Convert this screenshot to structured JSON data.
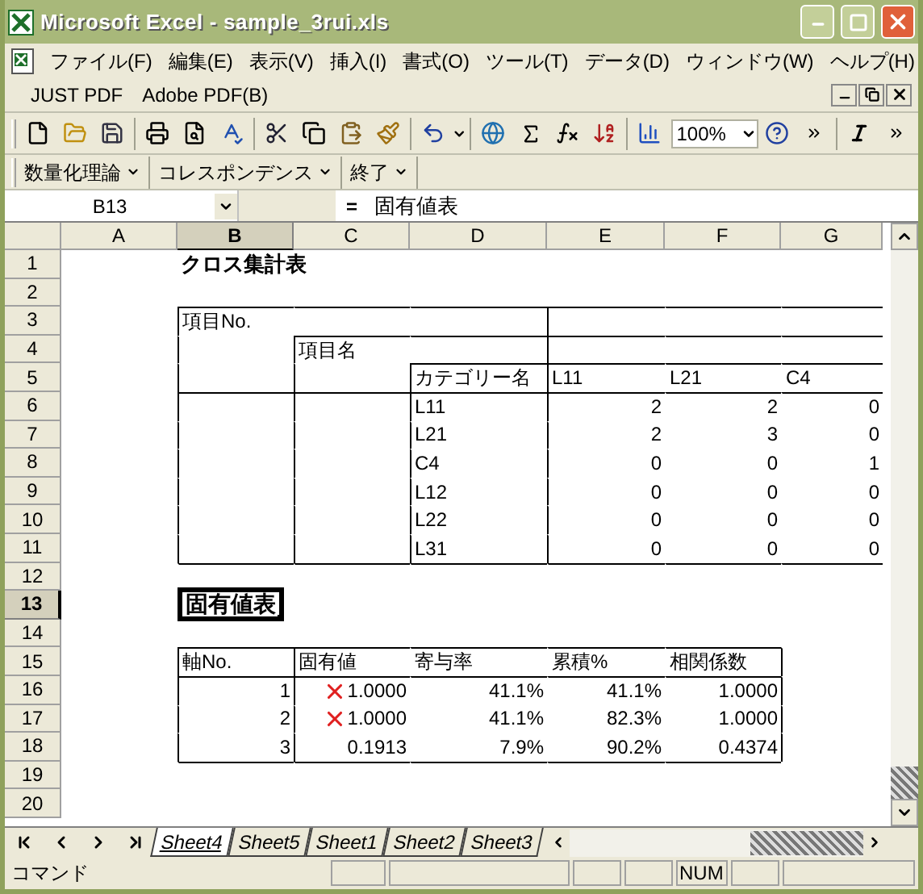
{
  "window": {
    "title": "Microsoft Excel - sample_3rui.xls"
  },
  "menu": [
    "ファイル(F)",
    "編集(E)",
    "表示(V)",
    "挿入(I)",
    "書式(O)",
    "ツール(T)",
    "データ(D)",
    "ウィンドウ(W)",
    "ヘルプ(H)"
  ],
  "menu_row2": [
    "JUST PDF",
    "Adobe PDF(B)"
  ],
  "zoom": "100%",
  "addin_menu": [
    "数量化理論",
    "コレスポンデンス",
    "終了"
  ],
  "name_box": "B13",
  "formula_equals": "=",
  "formula": "固有値表",
  "columns": [
    {
      "label": "A",
      "selected": false
    },
    {
      "label": "B",
      "selected": true
    },
    {
      "label": "C",
      "selected": false
    },
    {
      "label": "D",
      "selected": false
    },
    {
      "label": "E",
      "selected": false
    },
    {
      "label": "F",
      "selected": false
    },
    {
      "label": "G",
      "selected": false
    }
  ],
  "rows": [
    {
      "label": "1",
      "selected": false
    },
    {
      "label": "2",
      "selected": false
    },
    {
      "label": "3",
      "selected": false
    },
    {
      "label": "4",
      "selected": false
    },
    {
      "label": "5",
      "selected": false
    },
    {
      "label": "6",
      "selected": false
    },
    {
      "label": "7",
      "selected": false
    },
    {
      "label": "8",
      "selected": false
    },
    {
      "label": "9",
      "selected": false
    },
    {
      "label": "10",
      "selected": false
    },
    {
      "label": "11",
      "selected": false
    },
    {
      "label": "12",
      "selected": false
    },
    {
      "label": "13",
      "selected": true
    },
    {
      "label": "14",
      "selected": false
    },
    {
      "label": "15",
      "selected": false
    },
    {
      "label": "16",
      "selected": false
    },
    {
      "label": "17",
      "selected": false
    },
    {
      "label": "18",
      "selected": false
    },
    {
      "label": "19",
      "selected": false
    },
    {
      "label": "20",
      "selected": false
    }
  ],
  "cross_title": "クロス集計表",
  "cross_table": {
    "item_no_header": "項目No.",
    "item_name_header": "項目名",
    "category_header": "カテゴリー名",
    "value_headers": [
      "L11",
      "L21",
      "C4"
    ],
    "rows": [
      {
        "category": "L11",
        "values": [
          "2",
          "2",
          "0"
        ]
      },
      {
        "category": "L21",
        "values": [
          "2",
          "3",
          "0"
        ]
      },
      {
        "category": "C4",
        "values": [
          "0",
          "0",
          "1"
        ]
      },
      {
        "category": "L12",
        "values": [
          "0",
          "0",
          "0"
        ]
      },
      {
        "category": "L22",
        "values": [
          "0",
          "0",
          "0"
        ]
      },
      {
        "category": "L31",
        "values": [
          "0",
          "0",
          "0"
        ]
      }
    ]
  },
  "eigen_title": {
    "text": "固有値表",
    "selected": true
  },
  "eigen_table": {
    "headers": [
      "軸No.",
      "固有値",
      "寄与率",
      "累積%",
      "相関係数"
    ],
    "rows": [
      {
        "axis": "1",
        "flagged": true,
        "eigenvalue": "1.0000",
        "contribution": "41.1%",
        "cumulative": "41.1%",
        "correlation": "1.0000"
      },
      {
        "axis": "2",
        "flagged": true,
        "eigenvalue": "1.0000",
        "contribution": "41.1%",
        "cumulative": "82.3%",
        "correlation": "1.0000"
      },
      {
        "axis": "3",
        "flagged": false,
        "eigenvalue": "0.1913",
        "contribution": "7.9%",
        "cumulative": "90.2%",
        "correlation": "0.4374"
      }
    ]
  },
  "sheet_tabs": [
    {
      "label": "Sheet4",
      "selected": true
    },
    {
      "label": "Sheet5",
      "selected": false
    },
    {
      "label": "Sheet1",
      "selected": false
    },
    {
      "label": "Sheet2",
      "selected": false
    },
    {
      "label": "Sheet3",
      "selected": false
    }
  ],
  "status": {
    "mode": "コマンド",
    "num": "NUM"
  }
}
